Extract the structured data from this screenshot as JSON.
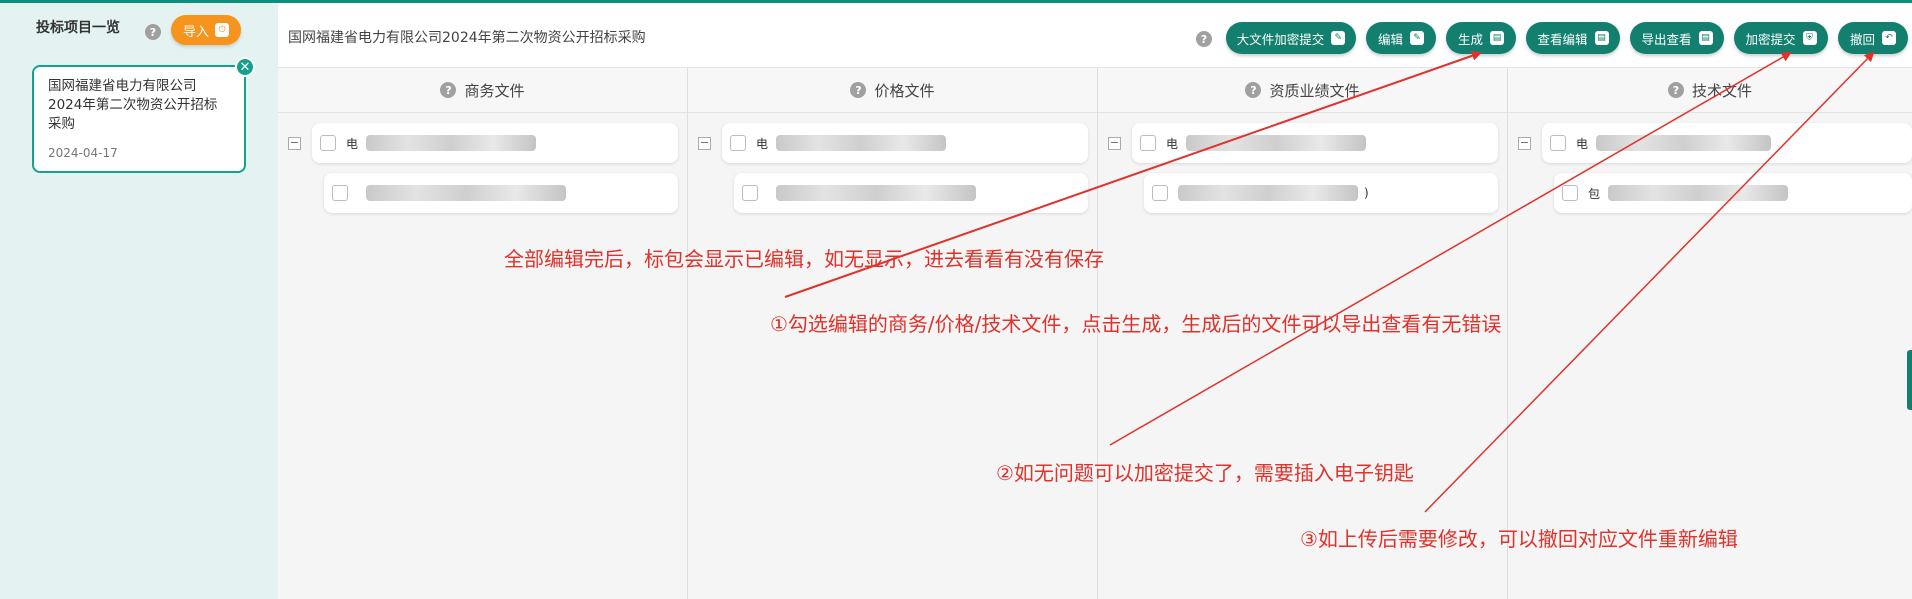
{
  "sidebar": {
    "title": "投标项目一览",
    "help_glyph": "?",
    "import_label": "导入",
    "project": {
      "title": "国网福建省电力有限公司2024年第二次物资公开招标采购",
      "date": "2024-04-17"
    }
  },
  "header": {
    "title": "国网福建省电力有限公司2024年第二次物资公开招标采购",
    "help_glyph": "?",
    "toolbar": [
      {
        "label": "大文件加密提交",
        "icon": "edit-icon"
      },
      {
        "label": "编辑",
        "icon": "edit-icon"
      },
      {
        "label": "生成",
        "icon": "document-icon"
      },
      {
        "label": "查看编辑",
        "icon": "document-icon"
      },
      {
        "label": "导出查看",
        "icon": "document-icon"
      },
      {
        "label": "加密提交",
        "icon": "shield-icon"
      },
      {
        "label": "撤回",
        "icon": "undo-icon"
      }
    ]
  },
  "columns": [
    {
      "title": "商务文件",
      "item1_prefix": "电",
      "item2_prefix": ""
    },
    {
      "title": "价格文件",
      "item1_prefix": "电",
      "item2_prefix": ""
    },
    {
      "title": "资质业绩文件",
      "item1_prefix": "电",
      "item2_prefix": ")"
    },
    {
      "title": "技术文件",
      "item1_prefix": "电",
      "item2_prefix": "包"
    }
  ],
  "annotations": {
    "note_top": "全部编辑完后，标包会显示已编辑，如无显示，进去看看有没有保存",
    "note_1": "①勾选编辑的商务/价格/技术文件，点击生成，生成后的文件可以导出查看有无错误",
    "note_2": "②如无问题可以加密提交了，需要插入电子钥匙",
    "note_3": "③如上传后需要修改，可以撤回对应文件重新编辑",
    "arrow_color": "#e0322b"
  },
  "colors": {
    "primary": "#13806f",
    "accent": "#f7941d",
    "sidebar_bg": "#e4f3f1"
  }
}
